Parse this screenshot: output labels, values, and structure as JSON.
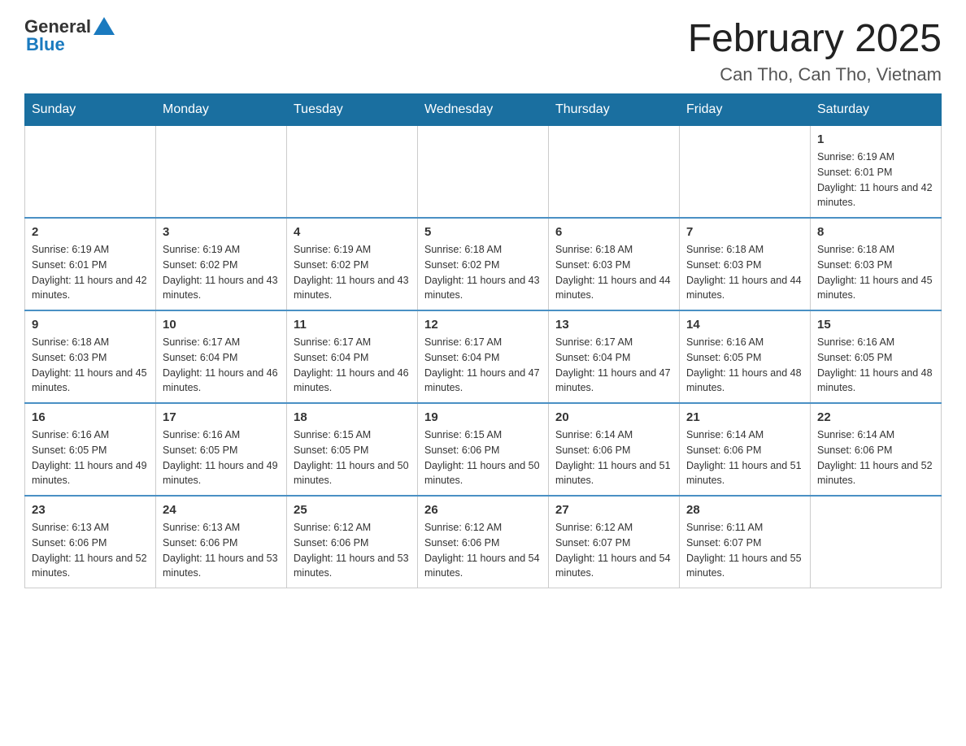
{
  "header": {
    "logo_general": "General",
    "logo_blue": "Blue",
    "month_title": "February 2025",
    "location": "Can Tho, Can Tho, Vietnam"
  },
  "days_of_week": [
    "Sunday",
    "Monday",
    "Tuesday",
    "Wednesday",
    "Thursday",
    "Friday",
    "Saturday"
  ],
  "weeks": [
    {
      "days": [
        {
          "number": "",
          "info": ""
        },
        {
          "number": "",
          "info": ""
        },
        {
          "number": "",
          "info": ""
        },
        {
          "number": "",
          "info": ""
        },
        {
          "number": "",
          "info": ""
        },
        {
          "number": "",
          "info": ""
        },
        {
          "number": "1",
          "info": "Sunrise: 6:19 AM\nSunset: 6:01 PM\nDaylight: 11 hours and 42 minutes."
        }
      ]
    },
    {
      "days": [
        {
          "number": "2",
          "info": "Sunrise: 6:19 AM\nSunset: 6:01 PM\nDaylight: 11 hours and 42 minutes."
        },
        {
          "number": "3",
          "info": "Sunrise: 6:19 AM\nSunset: 6:02 PM\nDaylight: 11 hours and 43 minutes."
        },
        {
          "number": "4",
          "info": "Sunrise: 6:19 AM\nSunset: 6:02 PM\nDaylight: 11 hours and 43 minutes."
        },
        {
          "number": "5",
          "info": "Sunrise: 6:18 AM\nSunset: 6:02 PM\nDaylight: 11 hours and 43 minutes."
        },
        {
          "number": "6",
          "info": "Sunrise: 6:18 AM\nSunset: 6:03 PM\nDaylight: 11 hours and 44 minutes."
        },
        {
          "number": "7",
          "info": "Sunrise: 6:18 AM\nSunset: 6:03 PM\nDaylight: 11 hours and 44 minutes."
        },
        {
          "number": "8",
          "info": "Sunrise: 6:18 AM\nSunset: 6:03 PM\nDaylight: 11 hours and 45 minutes."
        }
      ]
    },
    {
      "days": [
        {
          "number": "9",
          "info": "Sunrise: 6:18 AM\nSunset: 6:03 PM\nDaylight: 11 hours and 45 minutes."
        },
        {
          "number": "10",
          "info": "Sunrise: 6:17 AM\nSunset: 6:04 PM\nDaylight: 11 hours and 46 minutes."
        },
        {
          "number": "11",
          "info": "Sunrise: 6:17 AM\nSunset: 6:04 PM\nDaylight: 11 hours and 46 minutes."
        },
        {
          "number": "12",
          "info": "Sunrise: 6:17 AM\nSunset: 6:04 PM\nDaylight: 11 hours and 47 minutes."
        },
        {
          "number": "13",
          "info": "Sunrise: 6:17 AM\nSunset: 6:04 PM\nDaylight: 11 hours and 47 minutes."
        },
        {
          "number": "14",
          "info": "Sunrise: 6:16 AM\nSunset: 6:05 PM\nDaylight: 11 hours and 48 minutes."
        },
        {
          "number": "15",
          "info": "Sunrise: 6:16 AM\nSunset: 6:05 PM\nDaylight: 11 hours and 48 minutes."
        }
      ]
    },
    {
      "days": [
        {
          "number": "16",
          "info": "Sunrise: 6:16 AM\nSunset: 6:05 PM\nDaylight: 11 hours and 49 minutes."
        },
        {
          "number": "17",
          "info": "Sunrise: 6:16 AM\nSunset: 6:05 PM\nDaylight: 11 hours and 49 minutes."
        },
        {
          "number": "18",
          "info": "Sunrise: 6:15 AM\nSunset: 6:05 PM\nDaylight: 11 hours and 50 minutes."
        },
        {
          "number": "19",
          "info": "Sunrise: 6:15 AM\nSunset: 6:06 PM\nDaylight: 11 hours and 50 minutes."
        },
        {
          "number": "20",
          "info": "Sunrise: 6:14 AM\nSunset: 6:06 PM\nDaylight: 11 hours and 51 minutes."
        },
        {
          "number": "21",
          "info": "Sunrise: 6:14 AM\nSunset: 6:06 PM\nDaylight: 11 hours and 51 minutes."
        },
        {
          "number": "22",
          "info": "Sunrise: 6:14 AM\nSunset: 6:06 PM\nDaylight: 11 hours and 52 minutes."
        }
      ]
    },
    {
      "days": [
        {
          "number": "23",
          "info": "Sunrise: 6:13 AM\nSunset: 6:06 PM\nDaylight: 11 hours and 52 minutes."
        },
        {
          "number": "24",
          "info": "Sunrise: 6:13 AM\nSunset: 6:06 PM\nDaylight: 11 hours and 53 minutes."
        },
        {
          "number": "25",
          "info": "Sunrise: 6:12 AM\nSunset: 6:06 PM\nDaylight: 11 hours and 53 minutes."
        },
        {
          "number": "26",
          "info": "Sunrise: 6:12 AM\nSunset: 6:06 PM\nDaylight: 11 hours and 54 minutes."
        },
        {
          "number": "27",
          "info": "Sunrise: 6:12 AM\nSunset: 6:07 PM\nDaylight: 11 hours and 54 minutes."
        },
        {
          "number": "28",
          "info": "Sunrise: 6:11 AM\nSunset: 6:07 PM\nDaylight: 11 hours and 55 minutes."
        },
        {
          "number": "",
          "info": ""
        }
      ]
    }
  ]
}
